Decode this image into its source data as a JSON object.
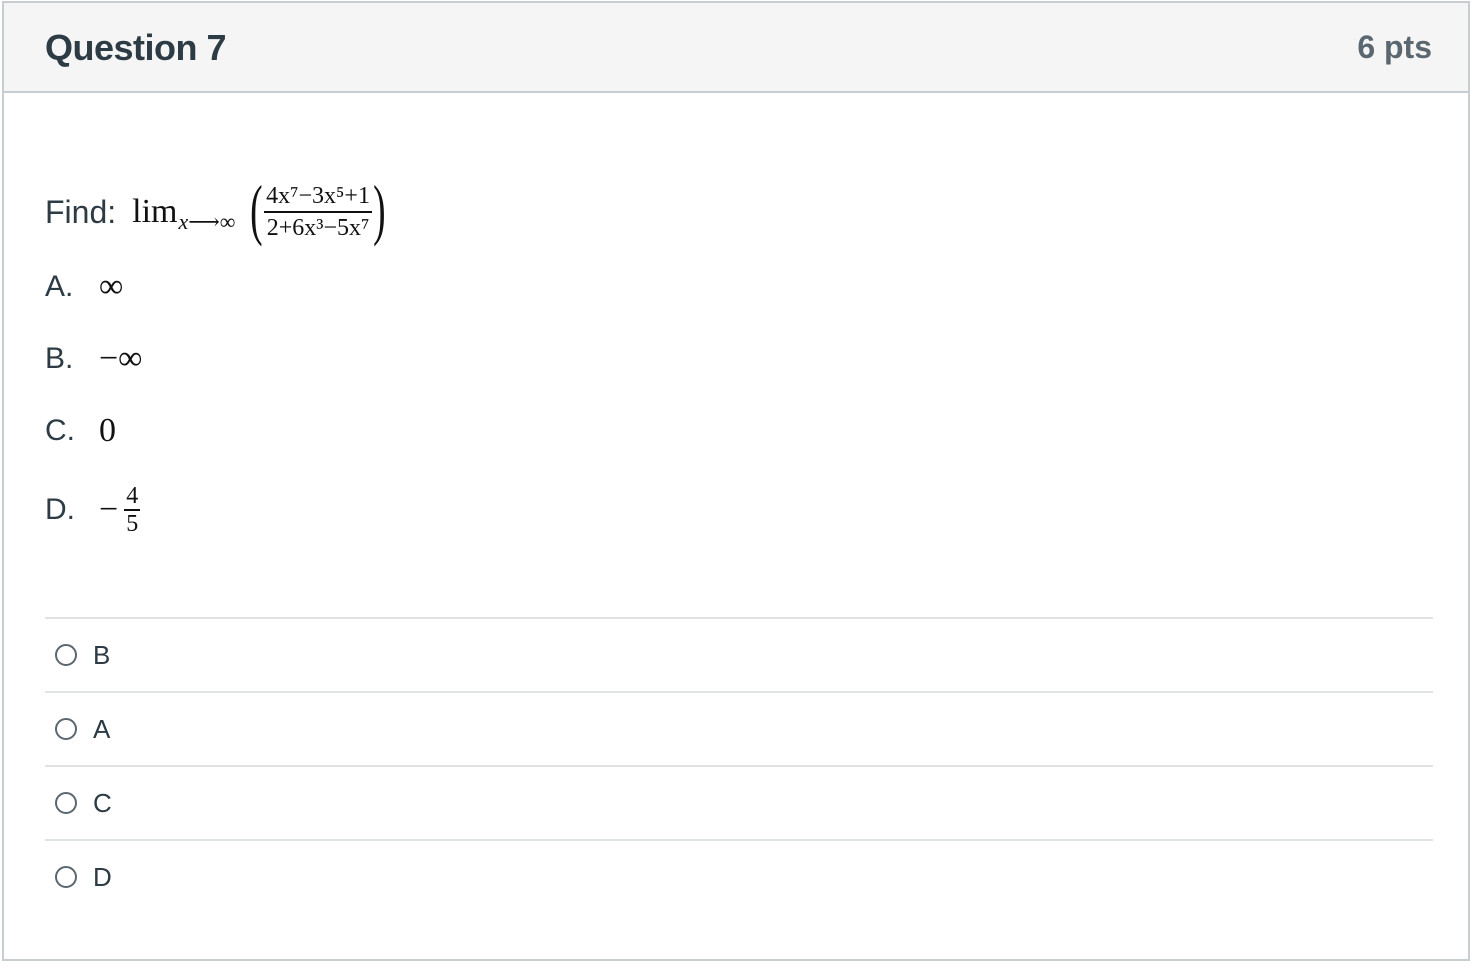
{
  "question": {
    "title": "Question 7",
    "points": "6 pts"
  },
  "prompt": {
    "label": "Find:",
    "lim": "lim",
    "subscript_var": "x",
    "subscript_arrow": "⟶∞",
    "open_paren": "(",
    "close_paren": ")",
    "numerator": "4x⁷−3x⁵+1",
    "denominator": "2+6x³−5x⁷"
  },
  "options": [
    {
      "letter": "A.",
      "value": "∞"
    },
    {
      "letter": "B.",
      "value": "−∞"
    },
    {
      "letter": "C.",
      "value": "0"
    },
    {
      "letter": "D.",
      "sign": "−",
      "numerator": "4",
      "denominator": "5"
    }
  ],
  "answers": [
    {
      "label": "B"
    },
    {
      "label": "A"
    },
    {
      "label": "C"
    },
    {
      "label": "D"
    }
  ]
}
